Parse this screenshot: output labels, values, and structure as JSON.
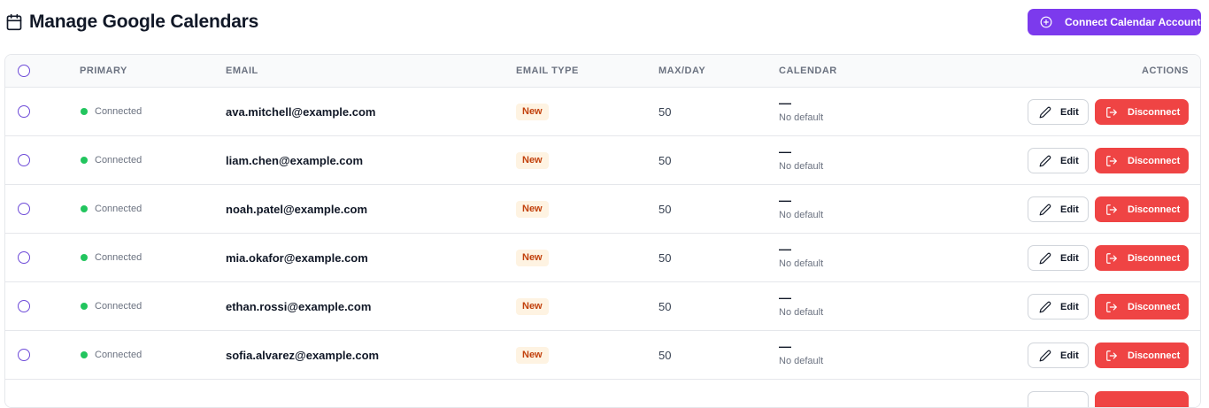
{
  "header": {
    "title": "Manage Google Calendars",
    "title_icon": "calendar-icon",
    "connect_button_label": "Connect Calendar Account",
    "connect_button_icon": "plus-circle-icon"
  },
  "colors": {
    "accent": "#7c3aed",
    "danger": "#ef4444",
    "connected": "#22c55e",
    "badge_bg": "#fef3e2",
    "badge_text": "#c2410c"
  },
  "table": {
    "columns": [
      "PRIMARY",
      "EMAIL",
      "EMAIL TYPE",
      "MAX/DAY",
      "CALENDAR",
      "ACTIONS"
    ],
    "rows": [
      {
        "status": "Connected",
        "email": "ava.mitchell@example.com",
        "email_type": "New",
        "max_day": "50",
        "calendar": "—",
        "calendar_sub": "No default",
        "edit_label": "Edit",
        "disconnect_label": "Disconnect"
      },
      {
        "status": "Connected",
        "email": "liam.chen@example.com",
        "email_type": "New",
        "max_day": "50",
        "calendar": "—",
        "calendar_sub": "No default",
        "edit_label": "Edit",
        "disconnect_label": "Disconnect"
      },
      {
        "status": "Connected",
        "email": "noah.patel@example.com",
        "email_type": "New",
        "max_day": "50",
        "calendar": "—",
        "calendar_sub": "No default",
        "edit_label": "Edit",
        "disconnect_label": "Disconnect"
      },
      {
        "status": "Connected",
        "email": "mia.okafor@example.com",
        "email_type": "New",
        "max_day": "50",
        "calendar": "—",
        "calendar_sub": "No default",
        "edit_label": "Edit",
        "disconnect_label": "Disconnect"
      },
      {
        "status": "Connected",
        "email": "ethan.rossi@example.com",
        "email_type": "New",
        "max_day": "50",
        "calendar": "—",
        "calendar_sub": "No default",
        "edit_label": "Edit",
        "disconnect_label": "Disconnect"
      },
      {
        "status": "Connected",
        "email": "sofia.alvarez@example.com",
        "email_type": "New",
        "max_day": "50",
        "calendar": "—",
        "calendar_sub": "No default",
        "edit_label": "Edit",
        "disconnect_label": "Disconnect"
      }
    ]
  }
}
